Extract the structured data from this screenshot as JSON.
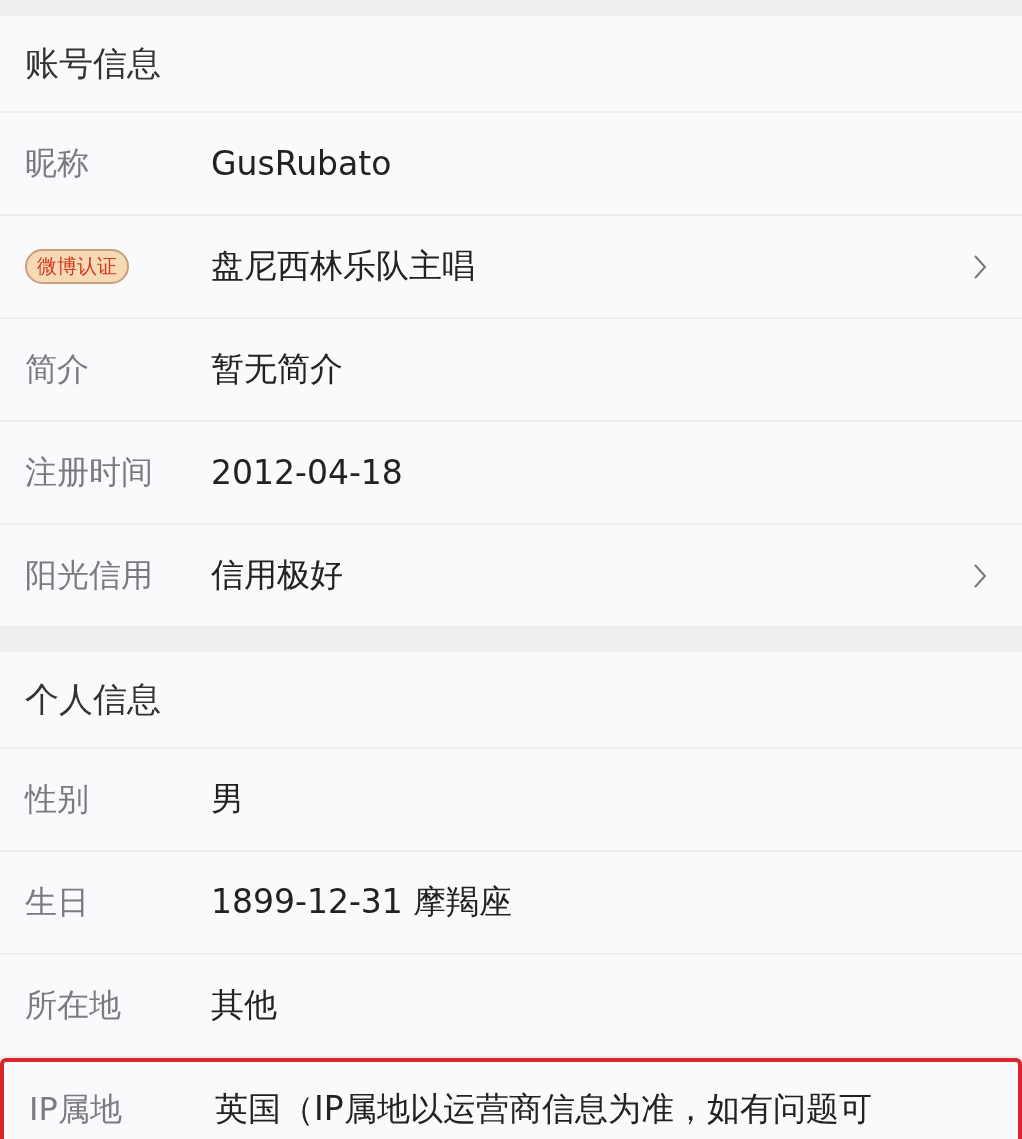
{
  "sections": [
    {
      "title": "账号信息",
      "rows": [
        {
          "kind": "text",
          "label": "昵称",
          "value": "GusRubato",
          "has_arrow": false,
          "highlighted": false
        },
        {
          "kind": "badge",
          "label": "微博认证",
          "value": "盘尼西林乐队主唱",
          "has_arrow": true,
          "highlighted": false
        },
        {
          "kind": "text",
          "label": "简介",
          "value": "暂无简介",
          "has_arrow": false,
          "highlighted": false
        },
        {
          "kind": "text",
          "label": "注册时间",
          "value": "2012-04-18",
          "has_arrow": false,
          "highlighted": false
        },
        {
          "kind": "text",
          "label": "阳光信用",
          "value": "信用极好",
          "has_arrow": true,
          "highlighted": false
        }
      ]
    },
    {
      "title": "个人信息",
      "rows": [
        {
          "kind": "text",
          "label": "性别",
          "value": "男",
          "has_arrow": false,
          "highlighted": false
        },
        {
          "kind": "text",
          "label": "生日",
          "value": "1899-12-31  摩羯座",
          "has_arrow": false,
          "highlighted": false
        },
        {
          "kind": "text",
          "label": "所在地",
          "value": "其他",
          "has_arrow": false,
          "highlighted": false
        },
        {
          "kind": "text",
          "label": "IP属地",
          "value": "英国（IP属地以运营商信息为准，如有问题可",
          "has_arrow": false,
          "highlighted": true
        }
      ]
    }
  ]
}
